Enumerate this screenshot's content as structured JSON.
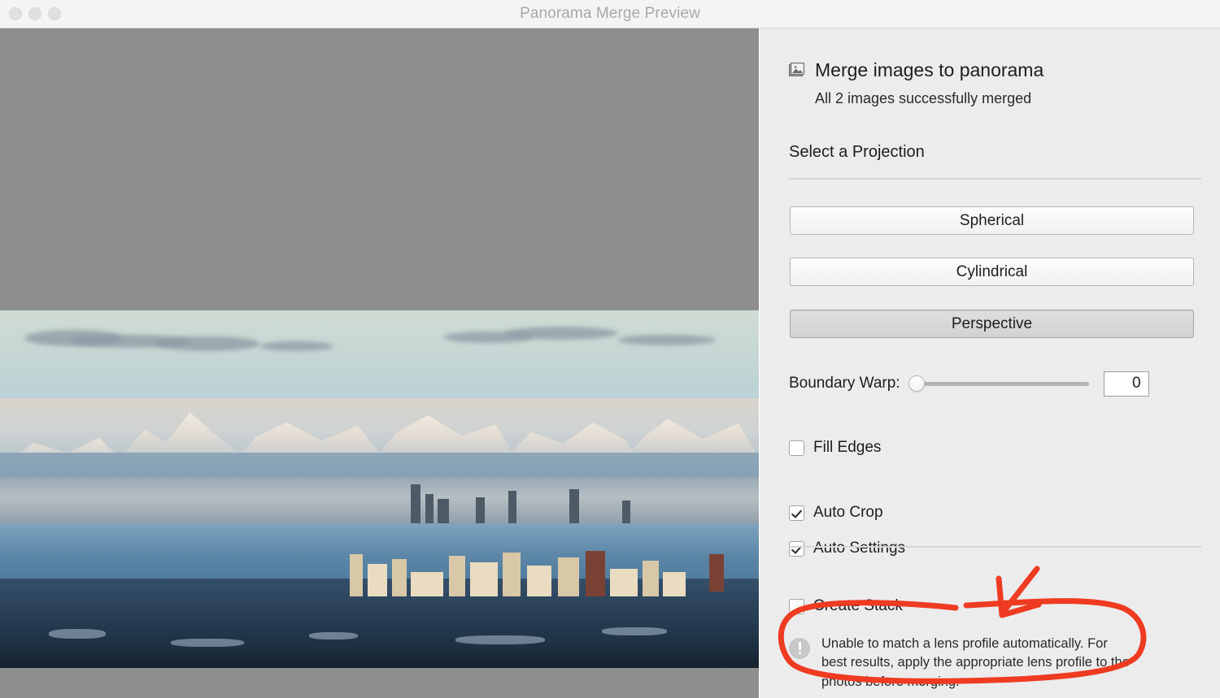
{
  "window": {
    "title": "Panorama Merge Preview",
    "traffic_lights": [
      "close-button",
      "minimize-button",
      "zoom-button"
    ]
  },
  "preview": {
    "icon": "panorama-photo",
    "description": "Merged panorama preview of a snowy city skyline with mountains and water",
    "background_color": "#8e8e8e"
  },
  "sidebar": {
    "header": {
      "icon": "image-stack-icon",
      "title": "Merge images to panorama",
      "subtitle": "All 2 images successfully merged"
    },
    "projection": {
      "section_label": "Select a Projection",
      "options": [
        {
          "label": "Spherical",
          "selected": false
        },
        {
          "label": "Cylindrical",
          "selected": false
        },
        {
          "label": "Perspective",
          "selected": true
        }
      ]
    },
    "boundary_warp": {
      "label": "Boundary Warp:",
      "value": "0",
      "slider_percent": 0,
      "min": 0,
      "max": 100
    },
    "checkboxes": [
      {
        "id": "fill-edges",
        "label": "Fill Edges",
        "checked": false
      },
      {
        "id": "auto-crop",
        "label": "Auto Crop",
        "checked": true
      },
      {
        "id": "auto-settings",
        "label": "Auto Settings",
        "checked": true
      },
      {
        "id": "create-stack",
        "label": "Create Stack",
        "checked": false
      }
    ],
    "warning": {
      "icon": "exclamation-circle-icon",
      "text": "Unable to match a lens profile automatically. For best results, apply the appropriate lens profile to the photos before merging."
    }
  },
  "annotation": {
    "color": "#ef3b21",
    "shapes": [
      "ellipse-around-warning",
      "arrow-pointing-to-warning"
    ]
  }
}
